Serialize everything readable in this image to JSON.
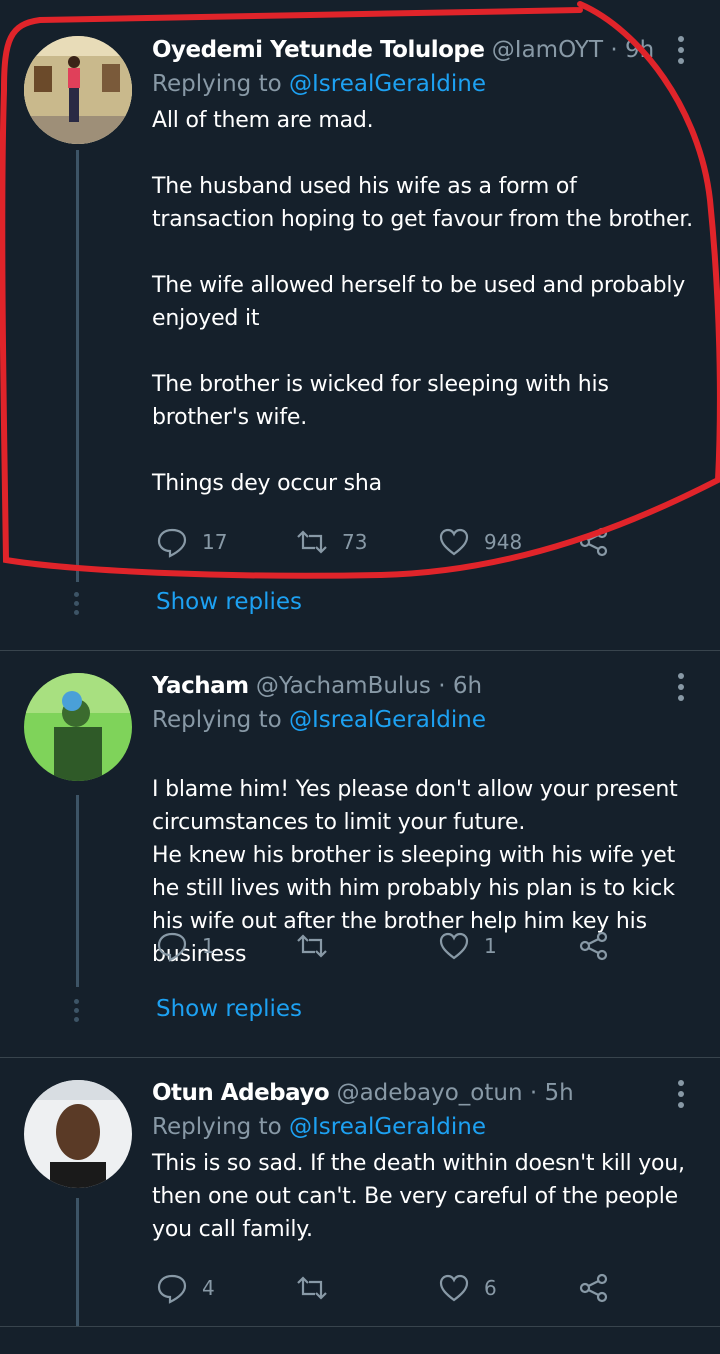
{
  "colors": {
    "background": "#15202b",
    "accent": "#1da1f2",
    "muted": "#8899a6",
    "highlight": "#e0242a"
  },
  "tweets": [
    {
      "name": "Oyedemi Yetunde Tolulope",
      "handle": "@IamOYT",
      "sep": "·",
      "time": "9h",
      "replying_prefix": "Replying to ",
      "replying_to": "@IsrealGeraldine",
      "paragraphs": [
        "All of them are mad.",
        "The husband used his wife as a form of transaction hoping to get favour from the brother.",
        "The wife allowed herself to be used and probably enjoyed it",
        "The brother is wicked for sleeping with his brother's wife.",
        "Things dey occur sha"
      ],
      "replies": "17",
      "retweets": "73",
      "likes": "948",
      "show_replies": "Show replies"
    },
    {
      "name": "Yacham",
      "handle": "@YachamBulus",
      "sep": "·",
      "time": "6h",
      "replying_prefix": "Replying to ",
      "replying_to": "@IsrealGeraldine",
      "paragraphs": [
        "I blame him! Yes please don't allow your present circumstances to limit your future.\nHe knew his brother is sleeping with his wife yet he still lives with him probably his plan is to kick his wife out after the brother help him key his business"
      ],
      "replies": "1",
      "retweets": "",
      "likes": "1",
      "show_replies": "Show replies"
    },
    {
      "name": "Otun Adebayo",
      "handle": "@adebayo_otun",
      "sep": "·",
      "time": "5h",
      "replying_prefix": "Replying to ",
      "replying_to": "@IsrealGeraldine",
      "paragraphs": [
        "This is so sad. If the death within doesn't kill you, then one out can't. Be very careful of the people you call family."
      ],
      "replies": "4",
      "retweets": "",
      "likes": "6"
    }
  ]
}
